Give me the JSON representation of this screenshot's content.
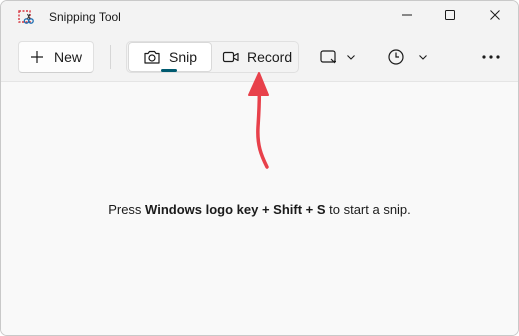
{
  "window": {
    "title": "Snipping Tool",
    "controls": {
      "minimize": "minimize-icon",
      "maximize": "maximize-icon",
      "close": "close-icon"
    }
  },
  "toolbar": {
    "new_label": "New",
    "snip_label": "Snip",
    "record_label": "Record",
    "selected_mode": "Snip",
    "shape_dropdown_icon": "rectangle-snip-icon",
    "delay_dropdown_icon": "clock-icon",
    "more_icon": "more-options-icon"
  },
  "content": {
    "hint_prefix": "Press ",
    "hint_keys": "Windows logo key + Shift + S",
    "hint_suffix": " to start a snip."
  },
  "annotation": {
    "arrow_color": "#e8414b",
    "points_to": "Record"
  },
  "colors": {
    "accent": "#005a70",
    "window_bg": "#f9f9f9",
    "titlebar_bg": "#f3f3f3"
  }
}
